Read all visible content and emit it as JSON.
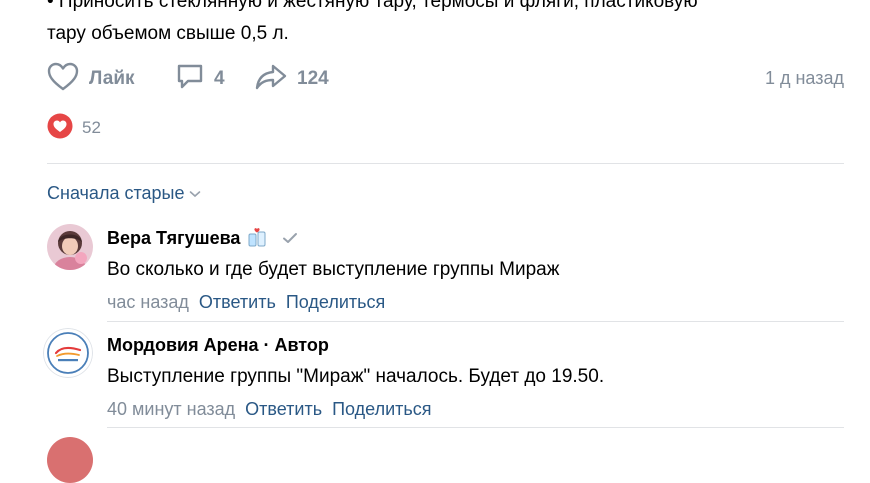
{
  "post": {
    "text_line1": "• Приносить стеклянную и жестяную тару, термосы и фляги, пластиковую",
    "text_line2": "тару объемом свыше 0,5 л."
  },
  "actions": {
    "like_label": "Лайк",
    "comments_count": "4",
    "shares_count": "124",
    "time_ago": "1 д назад"
  },
  "reactions": {
    "count": "52"
  },
  "comments_sort": {
    "label": "Сначала старые"
  },
  "comments": [
    {
      "author": "Вера Тягушева",
      "text": "Во сколько и где будет выступление группы Мираж",
      "time": "час назад",
      "reply_label": "Ответить",
      "share_label": "Поделиться"
    },
    {
      "author": "Мордовия Арена · Автор",
      "text": "Выступление группы \"Мираж\" началось. Будет до 19.50.",
      "time": "40 минут назад",
      "reply_label": "Ответить",
      "share_label": "Поделиться"
    }
  ],
  "colors": {
    "link": "#2a5885",
    "secondary": "#818c99",
    "like_red": "#e64646",
    "divider": "#e1e3e6"
  }
}
